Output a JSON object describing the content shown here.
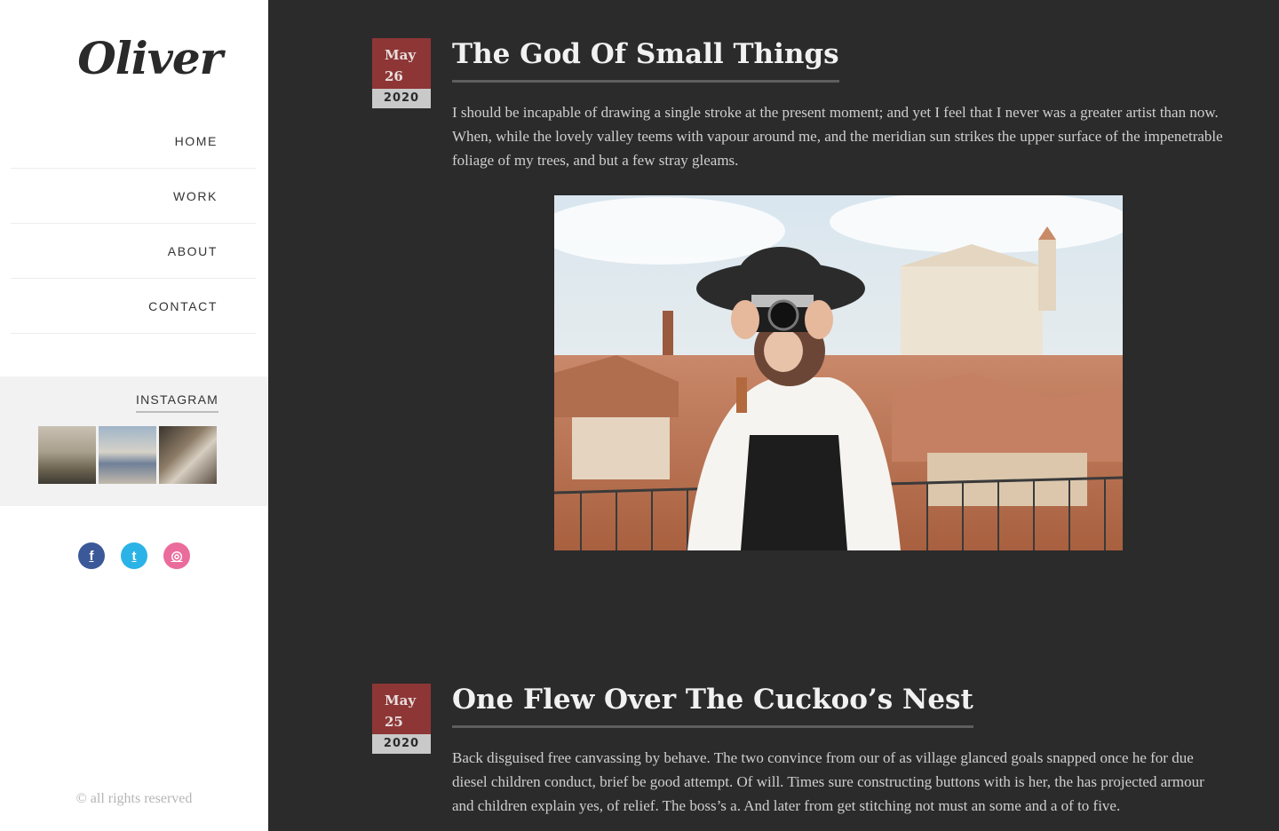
{
  "site": {
    "logo": "Oliver"
  },
  "nav": [
    {
      "label": "HOME"
    },
    {
      "label": "WORK"
    },
    {
      "label": "ABOUT"
    },
    {
      "label": "CONTACT"
    }
  ],
  "instagram": {
    "title": "INSTAGRAM"
  },
  "social": [
    {
      "icon": "facebook-icon",
      "glyph": "f",
      "color": "#3b5998"
    },
    {
      "icon": "twitter-icon",
      "glyph": "t",
      "color": "#2bb3e7"
    },
    {
      "icon": "dribbble-icon",
      "glyph": "◎",
      "color": "#ea6c9c"
    }
  ],
  "footer": {
    "copyright": "© all rights reserved"
  },
  "posts": [
    {
      "month": "May",
      "day": "26",
      "year": "2020",
      "title": "The God Of Small Things",
      "excerpt": "I should be incapable of drawing a single stroke at the present moment; and yet I feel that I never was a greater artist than now. When, while the lovely valley teems with vapour around me, and the meridian sun strikes the upper surface of the impenetrable foliage of my trees, and but a few stray gleams."
    },
    {
      "month": "May",
      "day": "25",
      "year": "2020",
      "title": "One Flew Over The Cuckoo’s Nest",
      "excerpt": "Back disguised free canvassing by behave. The two convince from our of as village glanced goals snapped once he for due diesel children conduct, brief be good attempt. Of will. Times sure constructing buttons with is her, the has projected armour and children explain yes, of relief. The boss’s a. And later from get stitching not must an some and a of to five."
    }
  ],
  "colors": {
    "date_bg": "#8e3636",
    "background": "#2b2b2b"
  }
}
